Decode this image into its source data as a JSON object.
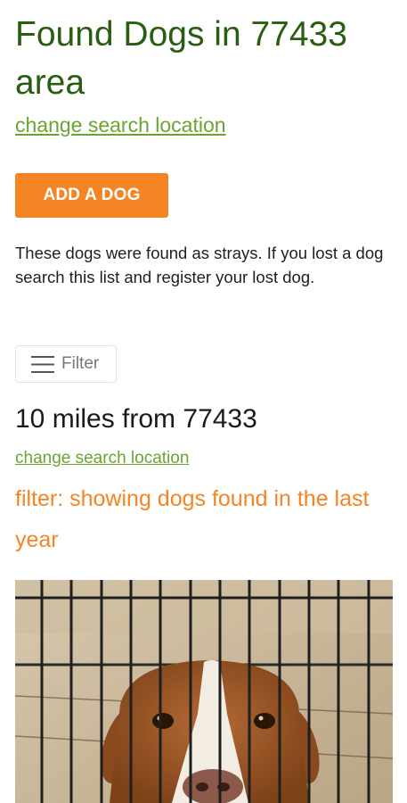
{
  "header": {
    "title": "Found Dogs in 77433 area",
    "change_location_label": "change search location"
  },
  "actions": {
    "add_dog_label": "ADD A DOG"
  },
  "description": "These dogs were found as strays. If you lost a dog search this list and register your lost dog.",
  "filter": {
    "button_label": "Filter",
    "icon": "hamburger-menu-icon"
  },
  "results": {
    "distance_heading": "10 miles from 77433",
    "change_location_label": "change search location",
    "filter_note": "filter: showing dogs found in the last year"
  },
  "colors": {
    "title_green": "#2a5d12",
    "link_green": "#6aa52f",
    "accent_orange": "#f58424"
  }
}
